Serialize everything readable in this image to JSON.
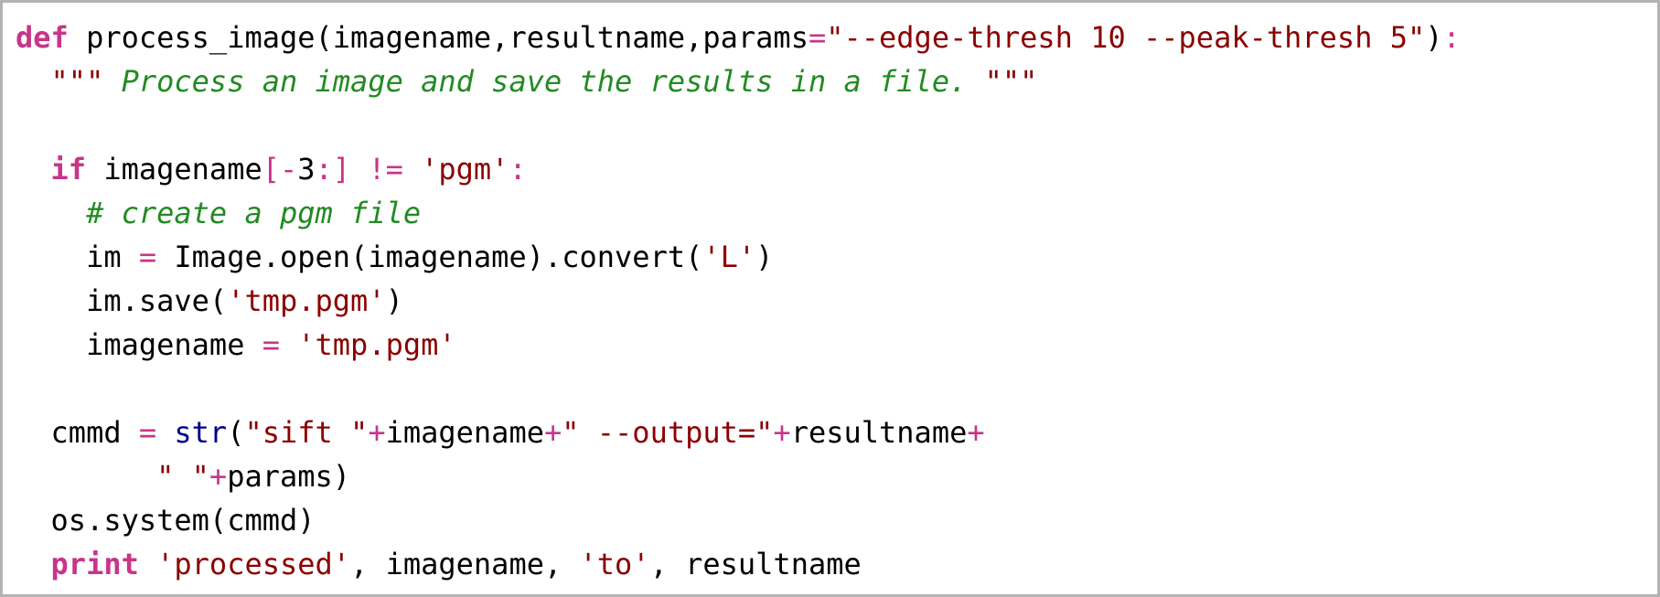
{
  "code": {
    "language": "python",
    "colors": {
      "keyword": "#c7358a",
      "operator": "#c7358a",
      "string": "#8b0000",
      "comment": "#228b22",
      "builtin": "#00008b",
      "text": "#000000",
      "border": "#b3b3b3"
    },
    "lines": [
      [
        {
          "t": "def",
          "c": "kw"
        },
        {
          "t": " process_image(imagename,resultname,params",
          "c": "id"
        },
        {
          "t": "=",
          "c": "op"
        },
        {
          "t": "\"--edge-thresh 10 --peak-thresh 5\"",
          "c": "str"
        },
        {
          "t": ")",
          "c": "id"
        },
        {
          "t": ":",
          "c": "op"
        }
      ],
      [
        {
          "t": "  ",
          "c": "id"
        },
        {
          "t": "\"\"\"",
          "c": "str"
        },
        {
          "t": " Process an image and save the results in a file. ",
          "c": "doc"
        },
        {
          "t": "\"\"\"",
          "c": "str"
        }
      ],
      [],
      [
        {
          "t": "  ",
          "c": "id"
        },
        {
          "t": "if",
          "c": "kw"
        },
        {
          "t": " imagename",
          "c": "id"
        },
        {
          "t": "[-",
          "c": "op"
        },
        {
          "t": "3",
          "c": "id"
        },
        {
          "t": ":]",
          "c": "op"
        },
        {
          "t": " ",
          "c": "id"
        },
        {
          "t": "!=",
          "c": "op"
        },
        {
          "t": " ",
          "c": "id"
        },
        {
          "t": "'pgm'",
          "c": "str"
        },
        {
          "t": ":",
          "c": "op"
        }
      ],
      [
        {
          "t": "    ",
          "c": "id"
        },
        {
          "t": "# create a pgm file",
          "c": "cmt"
        }
      ],
      [
        {
          "t": "    im ",
          "c": "id"
        },
        {
          "t": "=",
          "c": "op"
        },
        {
          "t": " Image.open(imagename).convert(",
          "c": "id"
        },
        {
          "t": "'L'",
          "c": "str"
        },
        {
          "t": ")",
          "c": "id"
        }
      ],
      [
        {
          "t": "    im.save(",
          "c": "id"
        },
        {
          "t": "'tmp.pgm'",
          "c": "str"
        },
        {
          "t": ")",
          "c": "id"
        }
      ],
      [
        {
          "t": "    imagename ",
          "c": "id"
        },
        {
          "t": "=",
          "c": "op"
        },
        {
          "t": " ",
          "c": "id"
        },
        {
          "t": "'tmp.pgm'",
          "c": "str"
        }
      ],
      [],
      [
        {
          "t": "  cmmd ",
          "c": "id"
        },
        {
          "t": "=",
          "c": "op"
        },
        {
          "t": " ",
          "c": "id"
        },
        {
          "t": "str",
          "c": "bi"
        },
        {
          "t": "(",
          "c": "id"
        },
        {
          "t": "\"sift \"",
          "c": "str"
        },
        {
          "t": "+",
          "c": "op"
        },
        {
          "t": "imagename",
          "c": "id"
        },
        {
          "t": "+",
          "c": "op"
        },
        {
          "t": "\" --output=\"",
          "c": "str"
        },
        {
          "t": "+",
          "c": "op"
        },
        {
          "t": "resultname",
          "c": "id"
        },
        {
          "t": "+",
          "c": "op"
        }
      ],
      [
        {
          "t": "        ",
          "c": "id"
        },
        {
          "t": "\" \"",
          "c": "str"
        },
        {
          "t": "+",
          "c": "op"
        },
        {
          "t": "params)",
          "c": "id"
        }
      ],
      [
        {
          "t": "  os.system(cmmd)",
          "c": "id"
        }
      ],
      [
        {
          "t": "  ",
          "c": "id"
        },
        {
          "t": "print",
          "c": "kw"
        },
        {
          "t": " ",
          "c": "id"
        },
        {
          "t": "'processed'",
          "c": "str"
        },
        {
          "t": ", imagename, ",
          "c": "id"
        },
        {
          "t": "'to'",
          "c": "str"
        },
        {
          "t": ", resultname",
          "c": "id"
        }
      ]
    ]
  }
}
